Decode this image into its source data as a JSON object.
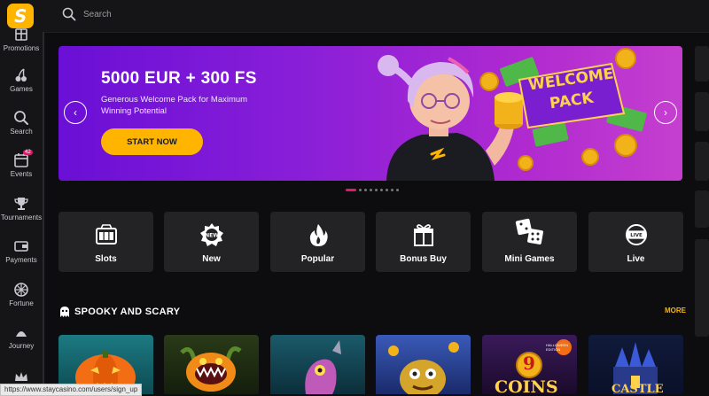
{
  "header": {
    "logo_letter": "S",
    "search_label": "Search"
  },
  "sidebar": {
    "items": [
      {
        "label": "Promotions",
        "icon": "promotions-icon"
      },
      {
        "label": "Games",
        "icon": "cherries-icon"
      },
      {
        "label": "Search",
        "icon": "search-icon"
      },
      {
        "label": "Events",
        "icon": "calendar-icon",
        "badge": "42"
      },
      {
        "label": "Tournaments",
        "icon": "trophy-icon"
      },
      {
        "label": "Payments",
        "icon": "wallet-icon"
      },
      {
        "label": "Fortune",
        "icon": "fortune-wheel-icon"
      },
      {
        "label": "Journey",
        "icon": "journey-icon"
      },
      {
        "label": "",
        "icon": "crown-icon"
      }
    ]
  },
  "banner": {
    "title": "5000 EUR + 300 FS",
    "subtitle": "Generous Welcome Pack for Maximum Winning Potential",
    "cta": "START NOW",
    "art_text_line1": "WELCOME",
    "art_text_line2": "PACK",
    "slides_total": 9,
    "active_slide": 1
  },
  "categories": [
    {
      "label": "Slots",
      "icon": "slot-machine-icon"
    },
    {
      "label": "New",
      "icon": "new-badge-icon"
    },
    {
      "label": "Popular",
      "icon": "flame-icon"
    },
    {
      "label": "Bonus Buy",
      "icon": "gift-icon"
    },
    {
      "label": "Mini Games",
      "icon": "dice-icon"
    },
    {
      "label": "Live",
      "icon": "live-icon"
    }
  ],
  "section": {
    "title": "SPOOKY AND SCARY",
    "more_label": "MORE",
    "icon": "ghost-icon"
  },
  "games": [
    {
      "name": "pumpkin-slot"
    },
    {
      "name": "carnivorous-plant-slot"
    },
    {
      "name": "creature-slot"
    },
    {
      "name": "zombie-slot"
    },
    {
      "name": "9-coins-halloween",
      "art_text": "COINS",
      "art_number": "9",
      "art_badge": "HALLOWEEN EDITION"
    },
    {
      "name": "haunted-castle-slot",
      "art_text": "CASTLE"
    }
  ],
  "status_bar": {
    "url": "https://www.staycasino.com/users/sign_up"
  },
  "colors": {
    "accent": "#ffb400",
    "pink": "#e0186e",
    "background": "#0d0d0f",
    "banner_start": "#6a0fd6",
    "banner_end": "#c53fcf"
  }
}
